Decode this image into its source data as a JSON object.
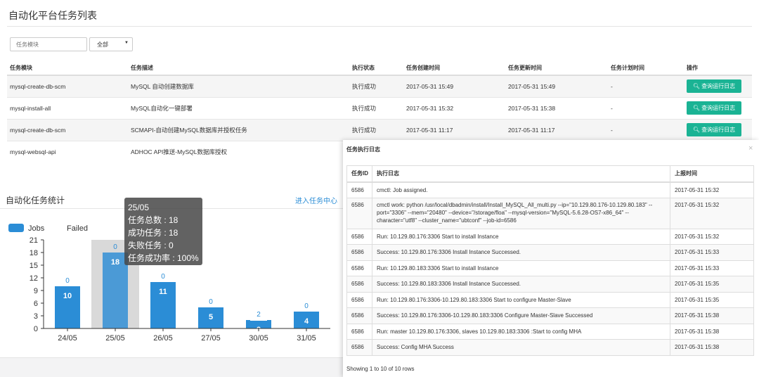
{
  "page": {
    "title": "自动化平台任务列表"
  },
  "filters": {
    "search_placeholder": "任务模块",
    "select_value": "全部",
    "select_caret": "▼"
  },
  "task_table": {
    "headers": [
      "任务模块",
      "任务描述",
      "执行状态",
      "任务创建时间",
      "任务更新时间",
      "任务计划时间",
      "操作"
    ],
    "rows": [
      {
        "module": "mysql-create-db-scm",
        "desc": "MySQL 自动创建数据库",
        "status": "执行成功",
        "created": "2017-05-31 15:49",
        "updated": "2017-05-31 15:49",
        "planned": "-",
        "action": "查询运行日志"
      },
      {
        "module": "mysql-install-all",
        "desc": "MySQL自动化一键部署",
        "status": "执行成功",
        "created": "2017-05-31 15:32",
        "updated": "2017-05-31 15:38",
        "planned": "-",
        "action": "查询运行日志"
      },
      {
        "module": "mysql-create-db-scm",
        "desc": "SCMAPI-自动创建MySQL数据库并授权任务",
        "status": "执行成功",
        "created": "2017-05-31 11:17",
        "updated": "2017-05-31 11:17",
        "planned": "-",
        "action": "查询运行日志"
      },
      {
        "module": "mysql-websql-api",
        "desc": "ADHOC API推送-MySQL数据库授权",
        "status": "",
        "created": "",
        "updated": "",
        "planned": "",
        "action": ""
      }
    ]
  },
  "stats": {
    "title": "自动化任务统计",
    "link": "进入任务中心"
  },
  "chart_data": {
    "type": "bar",
    "categories": [
      "24/05",
      "25/05",
      "26/05",
      "27/05",
      "30/05",
      "31/05"
    ],
    "series": [
      {
        "name": "Jobs",
        "values": [
          10,
          18,
          11,
          5,
          2,
          4
        ],
        "color": "#2b8dd6"
      },
      {
        "name": "Failed",
        "values": [
          0,
          0,
          0,
          0,
          2,
          0
        ],
        "color": "#2b8dd6"
      }
    ],
    "ylim": [
      0,
      21
    ],
    "yticks": [
      0,
      3,
      6,
      9,
      12,
      15,
      18,
      21
    ],
    "legend_position": "top-left",
    "highlight_category": "25/05"
  },
  "tooltip": {
    "lines": [
      "25/05",
      "任务总数 : 18",
      "成功任务 : 18",
      "失败任务 : 0",
      "任务成功率 : 100%"
    ]
  },
  "log_panel": {
    "title": "任务执行日志",
    "close": "×",
    "headers": [
      "任务ID",
      "执行日志",
      "上报时间"
    ],
    "rows": [
      {
        "id": "6586",
        "log": "cmctl: Job assigned.",
        "time": "2017-05-31 15:32"
      },
      {
        "id": "6586",
        "log": "cmctl work: python /usr/local/dbadmin/install/Install_MySQL_All_multi.py --ip=\"10.129.80.176-10.129.80.183\" --port=\"3306\" --mem=\"20480\" --device=\"/storage/floa\" --mysql-version=\"MySQL-5.6.28-OS7-x86_64\" --character=\"utf8\" --cluster_name=\"ubtconf\" --job-id=6586",
        "time": "2017-05-31 15:32"
      },
      {
        "id": "6586",
        "log": "Run: 10.129.80.176:3306 Start to install Instance",
        "time": "2017-05-31 15:32"
      },
      {
        "id": "6586",
        "log": "Success: 10.129.80.176:3306 Install Instance Successed.",
        "time": "2017-05-31 15:33"
      },
      {
        "id": "6586",
        "log": "Run: 10.129.80.183:3306 Start to install Instance",
        "time": "2017-05-31 15:33"
      },
      {
        "id": "6586",
        "log": "Success: 10.129.80.183:3306 Install Instance Successed.",
        "time": "2017-05-31 15:35"
      },
      {
        "id": "6586",
        "log": "Run: 10.129.80.176:3306-10.129.80.183:3306 Start to configure Master-Slave",
        "time": "2017-05-31 15:35"
      },
      {
        "id": "6586",
        "log": "Success: 10.129.80.176:3306-10.129.80.183:3306 Configure Master-Slave Successed",
        "time": "2017-05-31 15:38"
      },
      {
        "id": "6586",
        "log": "Run: master 10.129.80.176:3306, slaves 10.129.80.183:3306 :Start to config MHA",
        "time": "2017-05-31 15:38"
      },
      {
        "id": "6586",
        "log": "Success: Config MHA Success",
        "time": "2017-05-31 15:38"
      }
    ],
    "footer": "Showing 1 to 10 of 10 rows"
  }
}
